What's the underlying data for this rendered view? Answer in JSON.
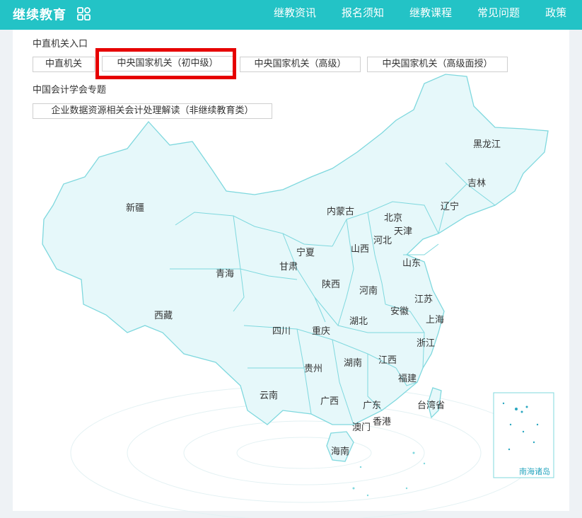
{
  "header": {
    "brand": "继续教育",
    "icon": "apps-grid-icon",
    "nav": [
      "继教资讯",
      "报名须知",
      "继教课程",
      "常见问题",
      "政策"
    ]
  },
  "colors": {
    "accent": "#23c3c6",
    "highlight": "#e60000",
    "map_fill": "#e6f8fa",
    "map_stroke": "#7fd8de"
  },
  "entry": {
    "title": "中直机关入口",
    "buttons": [
      "中直机关",
      "中央国家机关（初中级）",
      "中央国家机关（高级）",
      "中央国家机关（高级面授）"
    ]
  },
  "topic": {
    "title": "中国会计学会专题",
    "buttons": [
      "企业数据资源相关会计处理解读（非继续教育类）"
    ]
  },
  "map": {
    "provinces": [
      "黑龙江",
      "吉林",
      "辽宁",
      "内蒙古",
      "北京",
      "天津",
      "河北",
      "新疆",
      "宁夏",
      "山西",
      "甘肃",
      "青海",
      "山东",
      "陕西",
      "河南",
      "江苏",
      "西藏",
      "安徽",
      "湖北",
      "上海",
      "四川",
      "重庆",
      "浙江",
      "江西",
      "贵州",
      "湖南",
      "福建",
      "云南",
      "广西",
      "广东",
      "台湾省",
      "香港",
      "澳门",
      "海南"
    ],
    "inset_label": "南海诸岛"
  }
}
